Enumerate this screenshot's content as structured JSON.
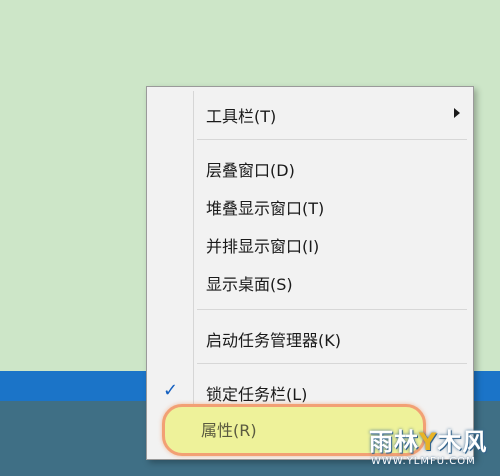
{
  "menu": {
    "items": [
      {
        "label": "工具栏(T)",
        "submenu": true
      },
      {
        "label": "层叠窗口(D)"
      },
      {
        "label": "堆叠显示窗口(T)"
      },
      {
        "label": "并排显示窗口(I)"
      },
      {
        "label": "显示桌面(S)"
      },
      {
        "label": "启动任务管理器(K)"
      },
      {
        "label": "锁定任务栏(L)",
        "checked": true
      },
      {
        "label": "属性(R)",
        "highlighted": true
      }
    ]
  },
  "watermark": {
    "logo_left": "雨林",
    "logo_y": "Y",
    "logo_right": "木风",
    "url": "WWW.YLMFU.COM"
  },
  "colors": {
    "desktop": "#cde6c8",
    "taskbar": "#1b74c8",
    "highlight_border": "#f2a074",
    "highlight_fill": "#eef29a",
    "check": "#1560c0"
  }
}
